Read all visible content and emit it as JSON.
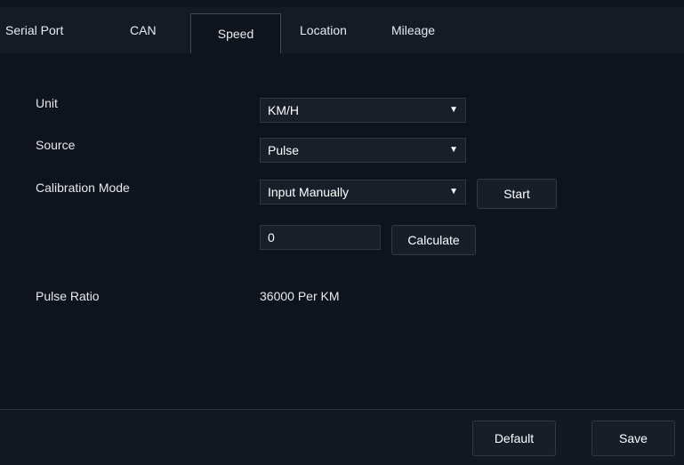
{
  "tabs": [
    {
      "label": "Serial Port"
    },
    {
      "label": "CAN"
    },
    {
      "label": "Speed",
      "active": true
    },
    {
      "label": "Location"
    },
    {
      "label": "Mileage"
    }
  ],
  "form": {
    "unit": {
      "label": "Unit",
      "value": "KM/H"
    },
    "source": {
      "label": "Source",
      "value": "Pulse"
    },
    "calibration_mode": {
      "label": "Calibration Mode",
      "value": "Input Manually",
      "start_label": "Start"
    },
    "manual_input": {
      "value": "0",
      "calculate_label": "Calculate"
    },
    "pulse_ratio": {
      "label": "Pulse Ratio",
      "value": "36000 Per KM"
    }
  },
  "footer": {
    "default_label": "Default",
    "save_label": "Save"
  },
  "icons": {
    "dropdown": "caret-down-icon"
  }
}
